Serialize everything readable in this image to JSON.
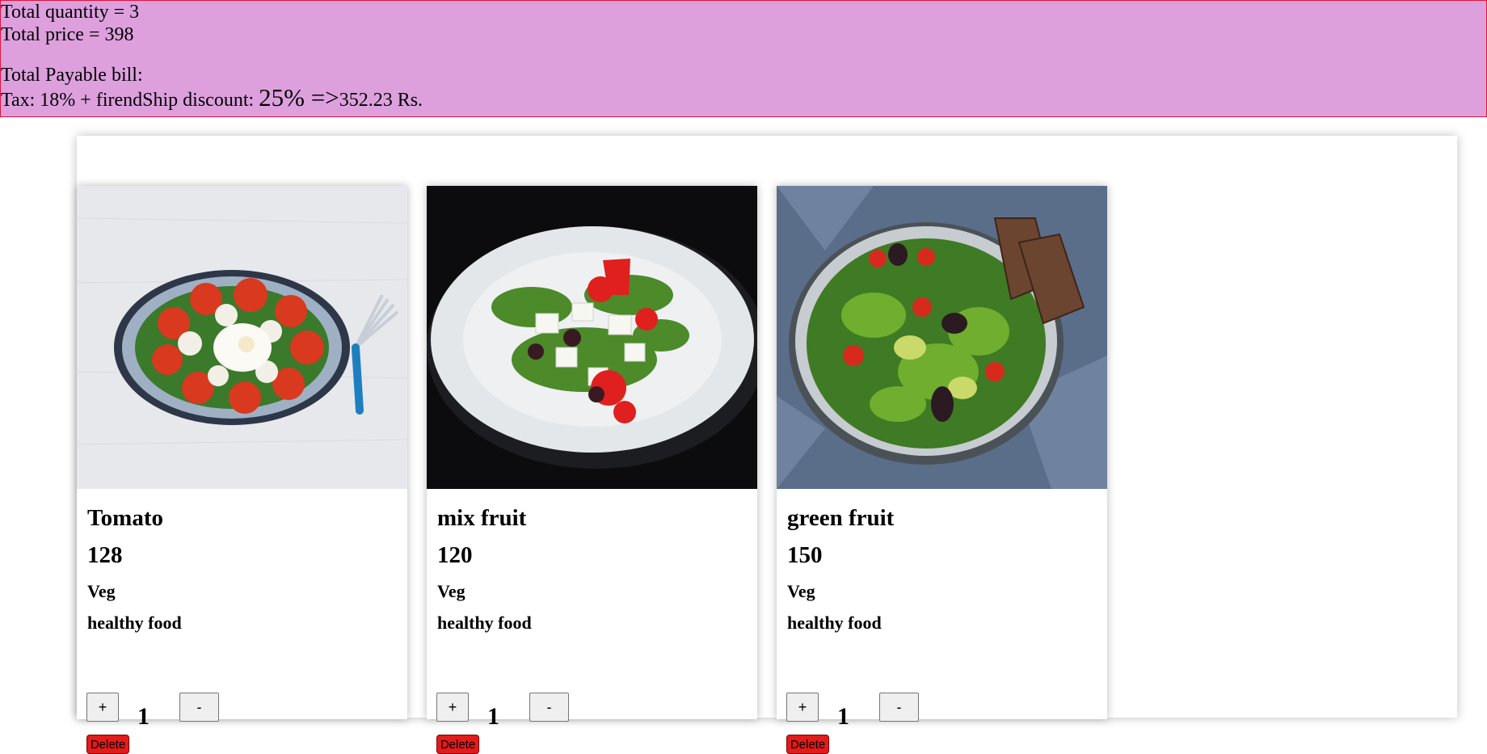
{
  "summary": {
    "total_quantity": "Total quantity = 3",
    "total_price": "Total price = 398",
    "payable_label": "Total Payable bill:",
    "tax_text": "Tax: 18% + firendShip discount: ",
    "discount_value": "25% =>",
    "final_amount": "352.23 Rs."
  },
  "products": [
    {
      "name": "Tomato",
      "price": "128",
      "category": "Veg",
      "description": "healthy food",
      "quantity": "1",
      "plus_label": "+",
      "minus_label": "-",
      "delete_label": "Delete",
      "image": "tomato-salad-photo"
    },
    {
      "name": "mix fruit",
      "price": "120",
      "category": "Veg",
      "description": "healthy food",
      "quantity": "1",
      "plus_label": "+",
      "minus_label": "-",
      "delete_label": "Delete",
      "image": "greek-salad-photo"
    },
    {
      "name": "green fruit",
      "price": "150",
      "category": "Veg",
      "description": "healthy food",
      "quantity": "1",
      "plus_label": "+",
      "minus_label": "-",
      "delete_label": "Delete",
      "image": "green-salad-photo"
    }
  ],
  "colors": {
    "summary_bg": "#dda0dd",
    "summary_border": "#e0143c",
    "delete_bg": "#e21b1b"
  }
}
